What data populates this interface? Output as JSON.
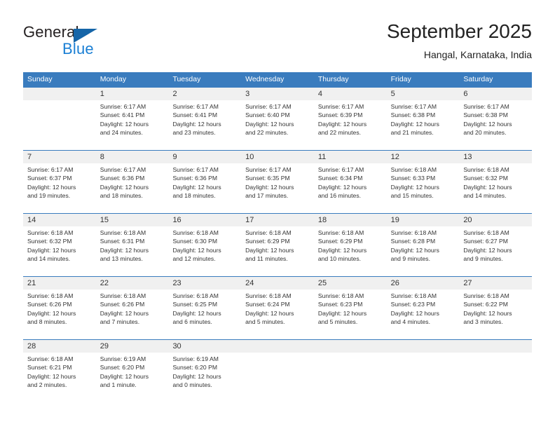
{
  "brand": {
    "name_part1": "General",
    "name_part2": "Blue",
    "accent_color": "#1a7fd4",
    "triangle_color": "#1565a8"
  },
  "header": {
    "title": "September 2025",
    "subtitle": "Hangal, Karnataka, India"
  },
  "calendar": {
    "header_color": "#3a7cbe",
    "weekday_row_bg": "#f0f0f0",
    "weekdays": [
      "Sunday",
      "Monday",
      "Tuesday",
      "Wednesday",
      "Thursday",
      "Friday",
      "Saturday"
    ],
    "weeks": [
      {
        "days": [
          {
            "num": "",
            "sunrise": "",
            "sunset": "",
            "daylight1": "",
            "daylight2": ""
          },
          {
            "num": "1",
            "sunrise": "Sunrise: 6:17 AM",
            "sunset": "Sunset: 6:41 PM",
            "daylight1": "Daylight: 12 hours",
            "daylight2": "and 24 minutes."
          },
          {
            "num": "2",
            "sunrise": "Sunrise: 6:17 AM",
            "sunset": "Sunset: 6:41 PM",
            "daylight1": "Daylight: 12 hours",
            "daylight2": "and 23 minutes."
          },
          {
            "num": "3",
            "sunrise": "Sunrise: 6:17 AM",
            "sunset": "Sunset: 6:40 PM",
            "daylight1": "Daylight: 12 hours",
            "daylight2": "and 22 minutes."
          },
          {
            "num": "4",
            "sunrise": "Sunrise: 6:17 AM",
            "sunset": "Sunset: 6:39 PM",
            "daylight1": "Daylight: 12 hours",
            "daylight2": "and 22 minutes."
          },
          {
            "num": "5",
            "sunrise": "Sunrise: 6:17 AM",
            "sunset": "Sunset: 6:38 PM",
            "daylight1": "Daylight: 12 hours",
            "daylight2": "and 21 minutes."
          },
          {
            "num": "6",
            "sunrise": "Sunrise: 6:17 AM",
            "sunset": "Sunset: 6:38 PM",
            "daylight1": "Daylight: 12 hours",
            "daylight2": "and 20 minutes."
          }
        ]
      },
      {
        "days": [
          {
            "num": "7",
            "sunrise": "Sunrise: 6:17 AM",
            "sunset": "Sunset: 6:37 PM",
            "daylight1": "Daylight: 12 hours",
            "daylight2": "and 19 minutes."
          },
          {
            "num": "8",
            "sunrise": "Sunrise: 6:17 AM",
            "sunset": "Sunset: 6:36 PM",
            "daylight1": "Daylight: 12 hours",
            "daylight2": "and 18 minutes."
          },
          {
            "num": "9",
            "sunrise": "Sunrise: 6:17 AM",
            "sunset": "Sunset: 6:36 PM",
            "daylight1": "Daylight: 12 hours",
            "daylight2": "and 18 minutes."
          },
          {
            "num": "10",
            "sunrise": "Sunrise: 6:17 AM",
            "sunset": "Sunset: 6:35 PM",
            "daylight1": "Daylight: 12 hours",
            "daylight2": "and 17 minutes."
          },
          {
            "num": "11",
            "sunrise": "Sunrise: 6:17 AM",
            "sunset": "Sunset: 6:34 PM",
            "daylight1": "Daylight: 12 hours",
            "daylight2": "and 16 minutes."
          },
          {
            "num": "12",
            "sunrise": "Sunrise: 6:18 AM",
            "sunset": "Sunset: 6:33 PM",
            "daylight1": "Daylight: 12 hours",
            "daylight2": "and 15 minutes."
          },
          {
            "num": "13",
            "sunrise": "Sunrise: 6:18 AM",
            "sunset": "Sunset: 6:32 PM",
            "daylight1": "Daylight: 12 hours",
            "daylight2": "and 14 minutes."
          }
        ]
      },
      {
        "days": [
          {
            "num": "14",
            "sunrise": "Sunrise: 6:18 AM",
            "sunset": "Sunset: 6:32 PM",
            "daylight1": "Daylight: 12 hours",
            "daylight2": "and 14 minutes."
          },
          {
            "num": "15",
            "sunrise": "Sunrise: 6:18 AM",
            "sunset": "Sunset: 6:31 PM",
            "daylight1": "Daylight: 12 hours",
            "daylight2": "and 13 minutes."
          },
          {
            "num": "16",
            "sunrise": "Sunrise: 6:18 AM",
            "sunset": "Sunset: 6:30 PM",
            "daylight1": "Daylight: 12 hours",
            "daylight2": "and 12 minutes."
          },
          {
            "num": "17",
            "sunrise": "Sunrise: 6:18 AM",
            "sunset": "Sunset: 6:29 PM",
            "daylight1": "Daylight: 12 hours",
            "daylight2": "and 11 minutes."
          },
          {
            "num": "18",
            "sunrise": "Sunrise: 6:18 AM",
            "sunset": "Sunset: 6:29 PM",
            "daylight1": "Daylight: 12 hours",
            "daylight2": "and 10 minutes."
          },
          {
            "num": "19",
            "sunrise": "Sunrise: 6:18 AM",
            "sunset": "Sunset: 6:28 PM",
            "daylight1": "Daylight: 12 hours",
            "daylight2": "and 9 minutes."
          },
          {
            "num": "20",
            "sunrise": "Sunrise: 6:18 AM",
            "sunset": "Sunset: 6:27 PM",
            "daylight1": "Daylight: 12 hours",
            "daylight2": "and 9 minutes."
          }
        ]
      },
      {
        "days": [
          {
            "num": "21",
            "sunrise": "Sunrise: 6:18 AM",
            "sunset": "Sunset: 6:26 PM",
            "daylight1": "Daylight: 12 hours",
            "daylight2": "and 8 minutes."
          },
          {
            "num": "22",
            "sunrise": "Sunrise: 6:18 AM",
            "sunset": "Sunset: 6:26 PM",
            "daylight1": "Daylight: 12 hours",
            "daylight2": "and 7 minutes."
          },
          {
            "num": "23",
            "sunrise": "Sunrise: 6:18 AM",
            "sunset": "Sunset: 6:25 PM",
            "daylight1": "Daylight: 12 hours",
            "daylight2": "and 6 minutes."
          },
          {
            "num": "24",
            "sunrise": "Sunrise: 6:18 AM",
            "sunset": "Sunset: 6:24 PM",
            "daylight1": "Daylight: 12 hours",
            "daylight2": "and 5 minutes."
          },
          {
            "num": "25",
            "sunrise": "Sunrise: 6:18 AM",
            "sunset": "Sunset: 6:23 PM",
            "daylight1": "Daylight: 12 hours",
            "daylight2": "and 5 minutes."
          },
          {
            "num": "26",
            "sunrise": "Sunrise: 6:18 AM",
            "sunset": "Sunset: 6:23 PM",
            "daylight1": "Daylight: 12 hours",
            "daylight2": "and 4 minutes."
          },
          {
            "num": "27",
            "sunrise": "Sunrise: 6:18 AM",
            "sunset": "Sunset: 6:22 PM",
            "daylight1": "Daylight: 12 hours",
            "daylight2": "and 3 minutes."
          }
        ]
      },
      {
        "days": [
          {
            "num": "28",
            "sunrise": "Sunrise: 6:18 AM",
            "sunset": "Sunset: 6:21 PM",
            "daylight1": "Daylight: 12 hours",
            "daylight2": "and 2 minutes."
          },
          {
            "num": "29",
            "sunrise": "Sunrise: 6:19 AM",
            "sunset": "Sunset: 6:20 PM",
            "daylight1": "Daylight: 12 hours",
            "daylight2": "and 1 minute."
          },
          {
            "num": "30",
            "sunrise": "Sunrise: 6:19 AM",
            "sunset": "Sunset: 6:20 PM",
            "daylight1": "Daylight: 12 hours",
            "daylight2": "and 0 minutes."
          },
          {
            "num": "",
            "sunrise": "",
            "sunset": "",
            "daylight1": "",
            "daylight2": ""
          },
          {
            "num": "",
            "sunrise": "",
            "sunset": "",
            "daylight1": "",
            "daylight2": ""
          },
          {
            "num": "",
            "sunrise": "",
            "sunset": "",
            "daylight1": "",
            "daylight2": ""
          },
          {
            "num": "",
            "sunrise": "",
            "sunset": "",
            "daylight1": "",
            "daylight2": ""
          }
        ]
      }
    ]
  }
}
